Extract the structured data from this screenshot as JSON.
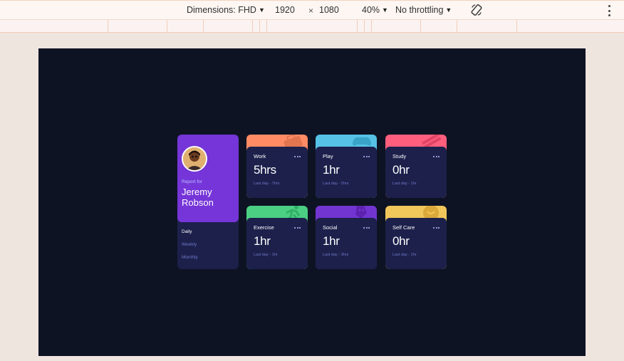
{
  "devtools": {
    "dimensions_label": "Dimensions: FHD",
    "width": "1920",
    "times": "×",
    "height": "1080",
    "zoom": "40%",
    "throttling": "No throttling",
    "icons": [
      "rotate-icon",
      "more-options-icon"
    ]
  },
  "profile": {
    "report_for": "Report for",
    "first_name": "Jeremy",
    "last_name": "Robson",
    "timeframes": [
      "Daily",
      "Weekly",
      "Monthly"
    ],
    "active_timeframe": "Daily"
  },
  "activities": [
    {
      "title": "Work",
      "hours": "5hrs",
      "previous": "Last day - 7hrs",
      "color": "#ff8b64",
      "icon": "briefcase-icon"
    },
    {
      "title": "Play",
      "hours": "1hr",
      "previous": "Last day - 2hrs",
      "color": "#55c2e6",
      "icon": "gamepad-icon"
    },
    {
      "title": "Study",
      "hours": "0hr",
      "previous": "Last day - 1hr",
      "color": "#ff5e7d",
      "icon": "book-icon"
    },
    {
      "title": "Exercise",
      "hours": "1hr",
      "previous": "Last day - 1hr",
      "color": "#4bcf82",
      "icon": "runner-icon"
    },
    {
      "title": "Social",
      "hours": "1hr",
      "previous": "Last day - 3hrs",
      "color": "#7335d2",
      "icon": "social-icon"
    },
    {
      "title": "Self Care",
      "hours": "0hr",
      "previous": "Last day - 1hr",
      "color": "#f1c75b",
      "icon": "self-care-icon"
    }
  ],
  "colors": {
    "page_bg": "#0e1323",
    "card_bg": "#1c204b",
    "profile_bg": "#7535d8"
  }
}
